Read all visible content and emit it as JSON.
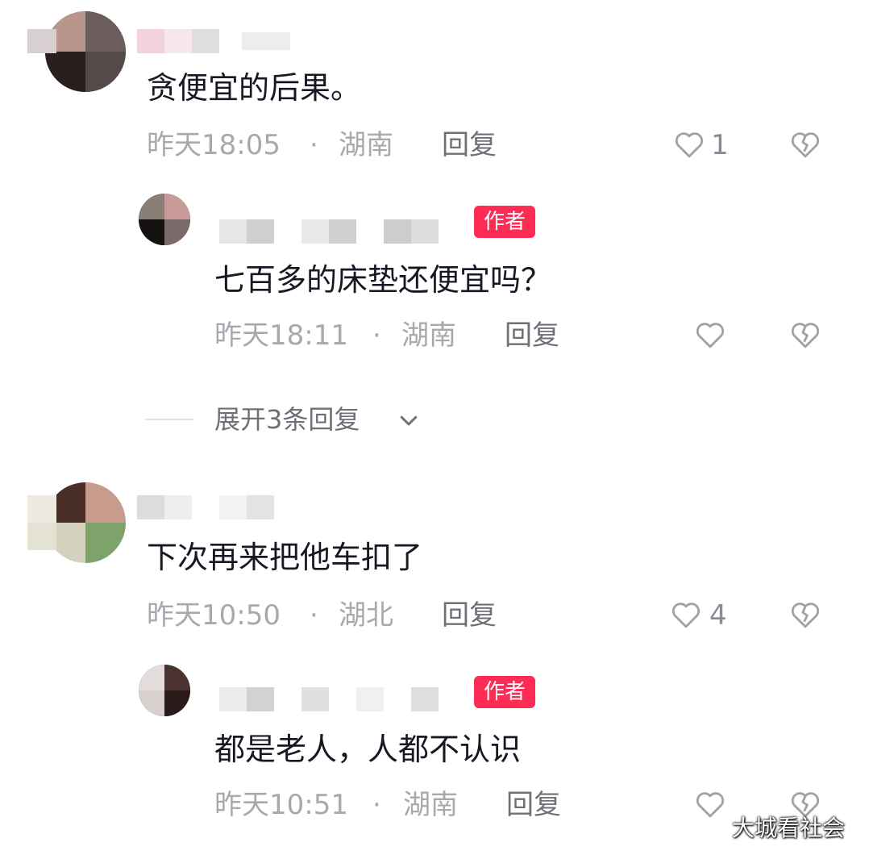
{
  "comments": [
    {
      "text": "贪便宜的后果。",
      "time": "昨天18:05",
      "sep": "·",
      "location": "湖南",
      "reply_label": "回复",
      "likes": "1",
      "replies": [
        {
          "badge": "作者",
          "text": "七百多的床垫还便宜吗？",
          "time": "昨天18:11",
          "sep": "·",
          "location": "湖南",
          "reply_label": "回复"
        }
      ],
      "expand_label": "展开3条回复"
    },
    {
      "text": "下次再来把他车扣了",
      "time": "昨天10:50",
      "sep": "·",
      "location": "湖北",
      "reply_label": "回复",
      "likes": "4",
      "replies": [
        {
          "badge": "作者",
          "text": "都是老人，人都不认识",
          "time": "昨天10:51",
          "sep": "·",
          "location": "湖南",
          "reply_label": "回复"
        }
      ]
    }
  ],
  "watermark": "大城看社会",
  "colors": {
    "badge": "#fe2c55",
    "meta": "#a8a8ae",
    "text": "#161823"
  },
  "icons": [
    "heart-outline-icon",
    "broken-heart-icon",
    "chevron-down-icon"
  ]
}
